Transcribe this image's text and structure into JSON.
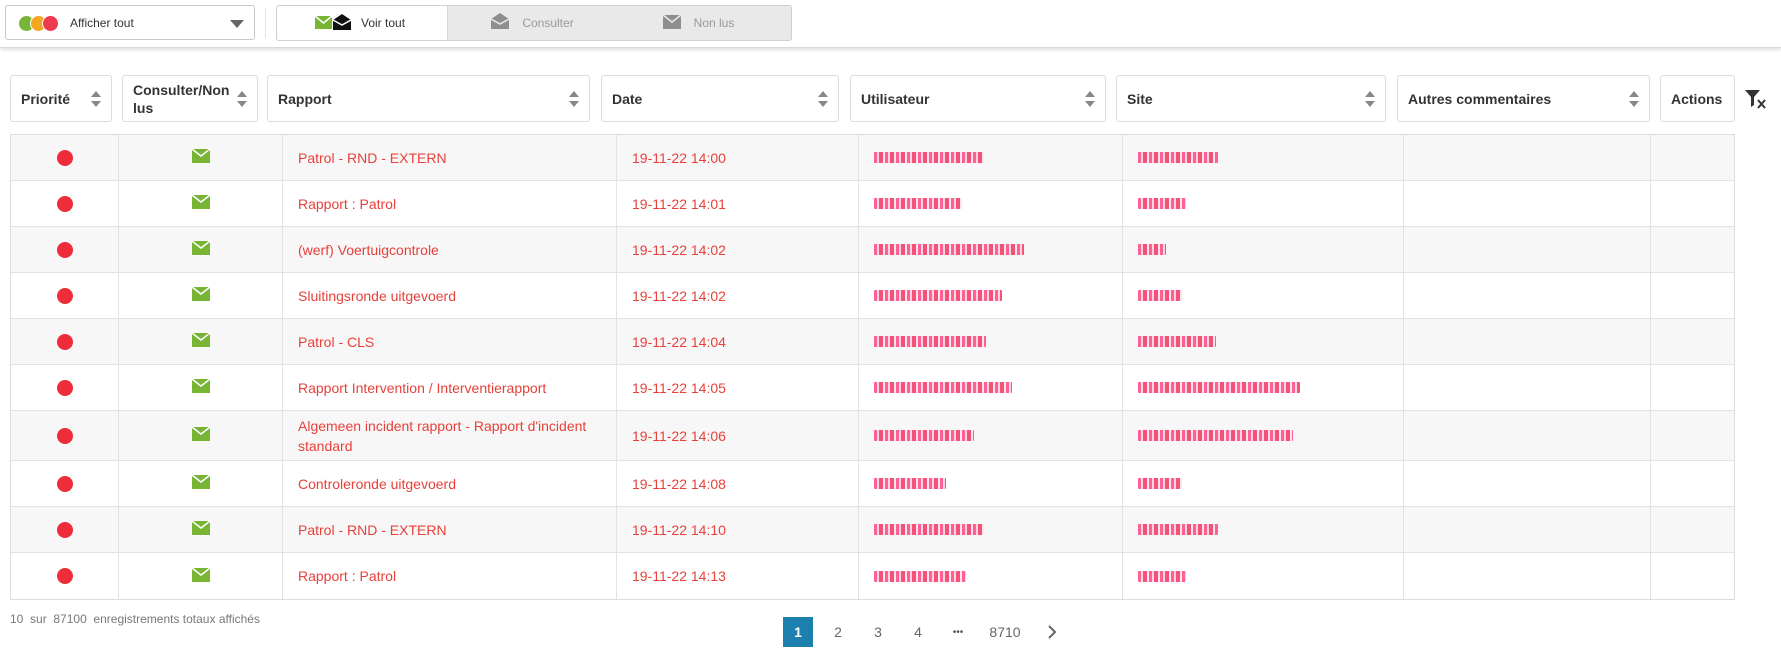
{
  "filter": {
    "label": "Afficher tout"
  },
  "view_tabs": [
    {
      "label": "Voir tout",
      "active": true
    },
    {
      "label": "Consulter",
      "active": false
    },
    {
      "label": "Non lus",
      "active": false
    }
  ],
  "table": {
    "columns": [
      "Priorité",
      "Consulter/Non lus",
      "Rapport",
      "Date",
      "Utilisateur",
      "Site",
      "Autres commentaires",
      "Actions"
    ],
    "rows": [
      {
        "priority": "red",
        "status": "read",
        "rapport": "Patrol - RND - EXTERN",
        "date": "19-11-22 14:00"
      },
      {
        "priority": "red",
        "status": "read",
        "rapport": "Rapport : Patrol",
        "date": "19-11-22 14:01"
      },
      {
        "priority": "red",
        "status": "read",
        "rapport": "(werf) Voertuigcontrole",
        "date": "19-11-22 14:02"
      },
      {
        "priority": "red",
        "status": "read",
        "rapport": "Sluitingsronde uitgevoerd",
        "date": "19-11-22 14:02"
      },
      {
        "priority": "red",
        "status": "read",
        "rapport": "Patrol - CLS",
        "date": "19-11-22 14:04"
      },
      {
        "priority": "red",
        "status": "read",
        "rapport": "Rapport Intervention / Interventierapport",
        "date": "19-11-22 14:05"
      },
      {
        "priority": "red",
        "status": "read",
        "rapport": "Algemeen incident rapport - Rapport d'incident standard",
        "date": "19-11-22 14:06"
      },
      {
        "priority": "red",
        "status": "read",
        "rapport": "Controleronde uitgevoerd",
        "date": "19-11-22 14:08"
      },
      {
        "priority": "red",
        "status": "read",
        "rapport": "Patrol - RND - EXTERN",
        "date": "19-11-22 14:10"
      },
      {
        "priority": "red",
        "status": "read",
        "rapport": "Rapport : Patrol",
        "date": "19-11-22 14:13"
      }
    ]
  },
  "footer": {
    "shown": "10",
    "sep": "sur",
    "total": "87100",
    "suffix": "enregistrements totaux affichés"
  },
  "pagination": {
    "pages": [
      "1",
      "2",
      "3",
      "4"
    ],
    "ellipsis": "•••",
    "last": "8710",
    "current": "1"
  },
  "colors": {
    "accent": "#1d7fae",
    "priority_red": "#ee2c3c",
    "link_red": "#e8403a",
    "mail_green": "#79b535"
  },
  "icons": [
    "envelope-icon",
    "open-envelope-icon",
    "sort-icon",
    "filter-clear-icon",
    "chevron-down-icon",
    "chevron-right-icon"
  ]
}
